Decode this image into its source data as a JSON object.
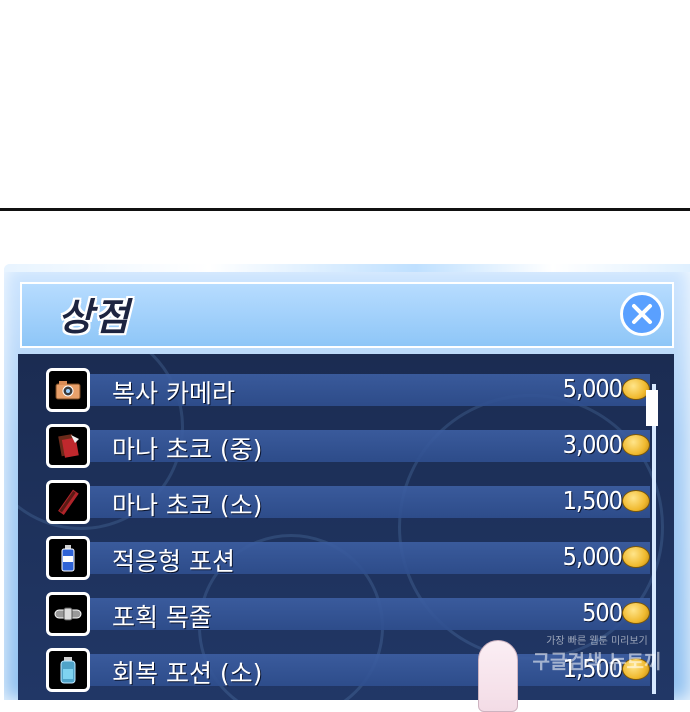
{
  "shop": {
    "title": "상점",
    "close_icon": "close-x-icon",
    "items": [
      {
        "name": "복사 카메라",
        "price": "5,000",
        "icon": "camera-icon"
      },
      {
        "name": "마나 초코 (중)",
        "price": "3,000",
        "icon": "chocolate-icon"
      },
      {
        "name": "마나 초코 (소)",
        "price": "1,500",
        "icon": "chocolate-bar-icon"
      },
      {
        "name": "적응형 포션",
        "price": "5,000",
        "icon": "potion-bottle-icon"
      },
      {
        "name": "포획 목줄",
        "price": "500",
        "icon": "collar-icon"
      },
      {
        "name": "회복 포션 (소)",
        "price": "1,500",
        "icon": "recovery-potion-icon"
      }
    ],
    "currency_icon": "gold-coin-icon"
  },
  "watermark": {
    "line1": "가장 빠른 웹툰 미리보기",
    "line2": "구글검색 뉴토끼"
  },
  "colors": {
    "panel": "#a9cff6",
    "list_bg": "#1b2c52",
    "row_bar": "#3d5fa3",
    "close_button": "#5aa0ff",
    "coin": "#f0b92e"
  }
}
